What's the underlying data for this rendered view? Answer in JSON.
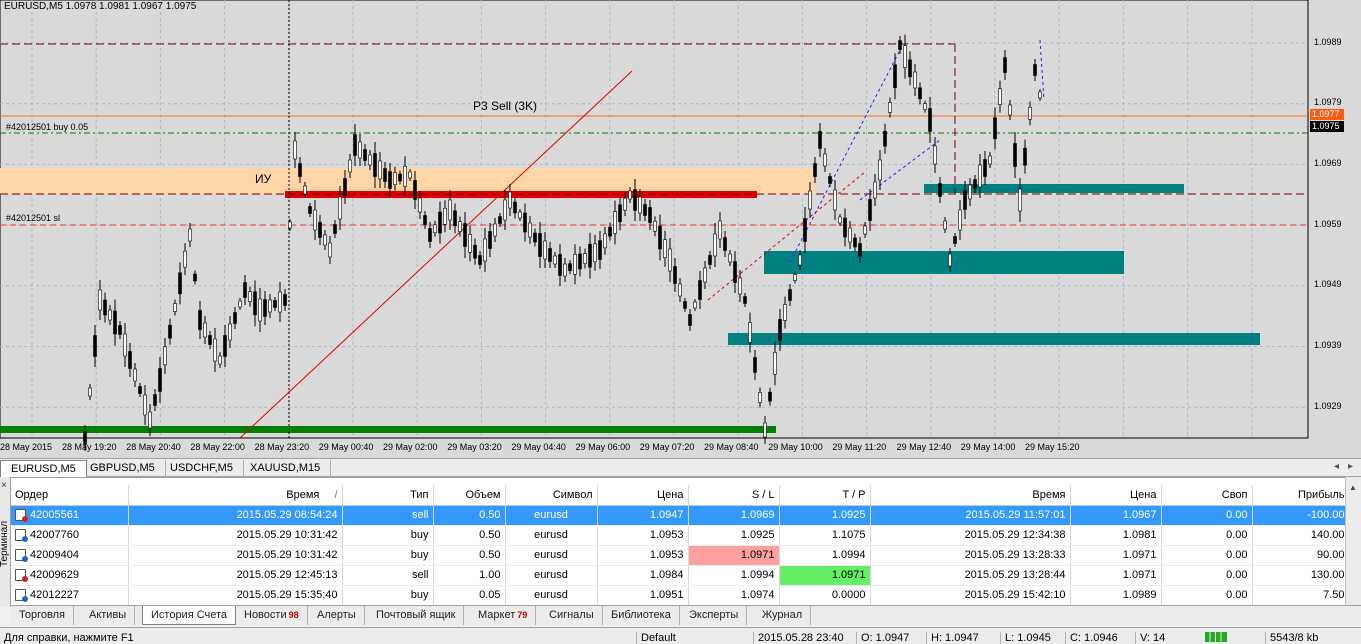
{
  "chart": {
    "title": "EURUSD,M5  1.0978 1.0981 1.0967 1.0975",
    "annotations": {
      "buy_label": "#42012501 buy 0.05",
      "sl_label": "#42012501 sl",
      "zone_label": "ИУ",
      "p3_label": "P3 Sell (3K)"
    },
    "price_axis": [
      "1.0989",
      "1.0979",
      "1.0969",
      "1.0959",
      "1.0949",
      "1.0939",
      "1.0929"
    ],
    "price_tags": [
      {
        "value": "1.0977",
        "color": "#ff5a14"
      },
      {
        "value": "1.0975",
        "color": "#000000"
      }
    ],
    "time_axis": [
      "28 May 2015",
      "28 May 19:20",
      "28 May 20:40",
      "28 May 22:00",
      "28 May 23:20",
      "29 May 00:40",
      "29 May 02:00",
      "29 May 03:20",
      "29 May 04:40",
      "29 May 06:00",
      "29 May 07:20",
      "29 May 08:40",
      "29 May 10:00",
      "29 May 11:20",
      "29 May 12:40",
      "29 May 14:00",
      "29 May 15:20"
    ],
    "colors": {
      "background": "#d9d9d9",
      "zone_orange": "#ffd6a8",
      "zone_red": "#e00000",
      "zone_green": "#008000",
      "zone_teal": "#008080",
      "candle": "#000000"
    }
  },
  "symbol_tabs": [
    "EURUSD,M5",
    "GBPUSD,M5",
    "USDCHF,M5",
    "XAUUSD,M15"
  ],
  "terminal": {
    "side_label": "Терминал",
    "columns": [
      "Ордер",
      "Время",
      "Тип",
      "Объем",
      "Символ",
      "Цена",
      "S / L",
      "T / P",
      "Время",
      "Цена",
      "Своп",
      "Прибыль"
    ],
    "sort_indicator": "/",
    "rows": [
      {
        "order": "42005561",
        "time": "2015.05.29 08:54:24",
        "type": "sell",
        "volume": "0.50",
        "symbol": "eurusd",
        "price": "1.0947",
        "sl": "1.0969",
        "tp": "1.0925",
        "close_time": "2015.05.29 11:57:01",
        "close_price": "1.0967",
        "swap": "0.00",
        "profit": "-100.00"
      },
      {
        "order": "42007760",
        "time": "2015.05.29 10:31:42",
        "type": "buy",
        "volume": "0.50",
        "symbol": "eurusd",
        "price": "1.0953",
        "sl": "1.0925",
        "tp": "1.1075",
        "close_time": "2015.05.29 12:34:38",
        "close_price": "1.0981",
        "swap": "0.00",
        "profit": "140.00"
      },
      {
        "order": "42009404",
        "time": "2015.05.29 10:31:42",
        "type": "buy",
        "volume": "0.50",
        "symbol": "eurusd",
        "price": "1.0953",
        "sl": "1.0971",
        "tp": "1.0994",
        "close_time": "2015.05.29 13:28:33",
        "close_price": "1.0971",
        "swap": "0.00",
        "profit": "90.00"
      },
      {
        "order": "42009629",
        "time": "2015.05.29 12:45:13",
        "type": "sell",
        "volume": "1.00",
        "symbol": "eurusd",
        "price": "1.0984",
        "sl": "1.0994",
        "tp": "1.0971",
        "close_time": "2015.05.29 13:28:44",
        "close_price": "1.0971",
        "swap": "0.00",
        "profit": "130.00"
      },
      {
        "order": "42012227",
        "time": "2015.05.29 15:35:40",
        "type": "buy",
        "volume": "0.05",
        "symbol": "eurusd",
        "price": "1.0951",
        "sl": "1.0974",
        "tp": "0.0000",
        "close_time": "2015.05.29 15:42:10",
        "close_price": "1.0989",
        "swap": "0.00",
        "profit": "7.50"
      }
    ]
  },
  "terminal_tabs": [
    {
      "label": "Торговля",
      "badge": ""
    },
    {
      "label": "Активы",
      "badge": ""
    },
    {
      "label": "История Счета",
      "badge": ""
    },
    {
      "label": "Новости",
      "badge": "98"
    },
    {
      "label": "Алерты",
      "badge": ""
    },
    {
      "label": "Почтовый ящик",
      "badge": ""
    },
    {
      "label": "Маркет",
      "badge": "79"
    },
    {
      "label": "Сигналы",
      "badge": ""
    },
    {
      "label": "Библиотека",
      "badge": ""
    },
    {
      "label": "Эксперты",
      "badge": ""
    },
    {
      "label": "Журнал",
      "badge": ""
    }
  ],
  "status_bar": {
    "help": "Для справки, нажмите F1",
    "profile": "Default",
    "datetime": "2015.05.28 23:40",
    "open": "O: 1.0947",
    "high": "H: 1.0947",
    "low": "L: 1.0945",
    "close": "C: 1.0946",
    "volume": "V: 14",
    "traffic": "5543/8 kb"
  }
}
